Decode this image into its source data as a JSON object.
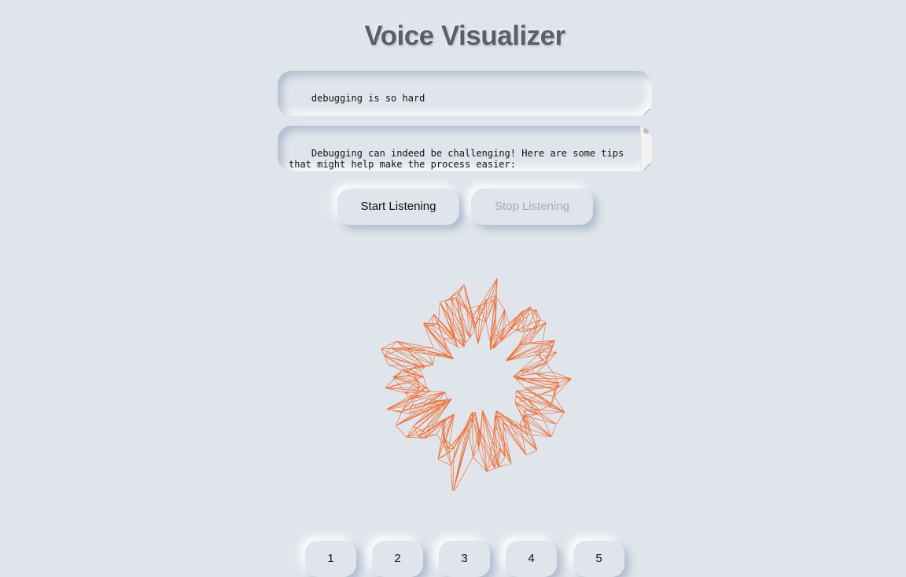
{
  "app": {
    "title": "Voice Visualizer"
  },
  "input": {
    "value": "debugging is so hard"
  },
  "output": {
    "value": "Debugging can indeed be challenging! Here are some tips\nthat might help make the process easier:"
  },
  "controls": {
    "start_label": "Start Listening",
    "stop_label": "Stop Listening",
    "stop_disabled": true
  },
  "visualizer": {
    "color": "#ee6a2f",
    "shape": "radial-mesh"
  },
  "pages": [
    "1",
    "2",
    "3",
    "4",
    "5"
  ],
  "colors": {
    "background": "#e0e5ec",
    "title": "#5c5f64",
    "disabled_text": "#a8aab0"
  }
}
